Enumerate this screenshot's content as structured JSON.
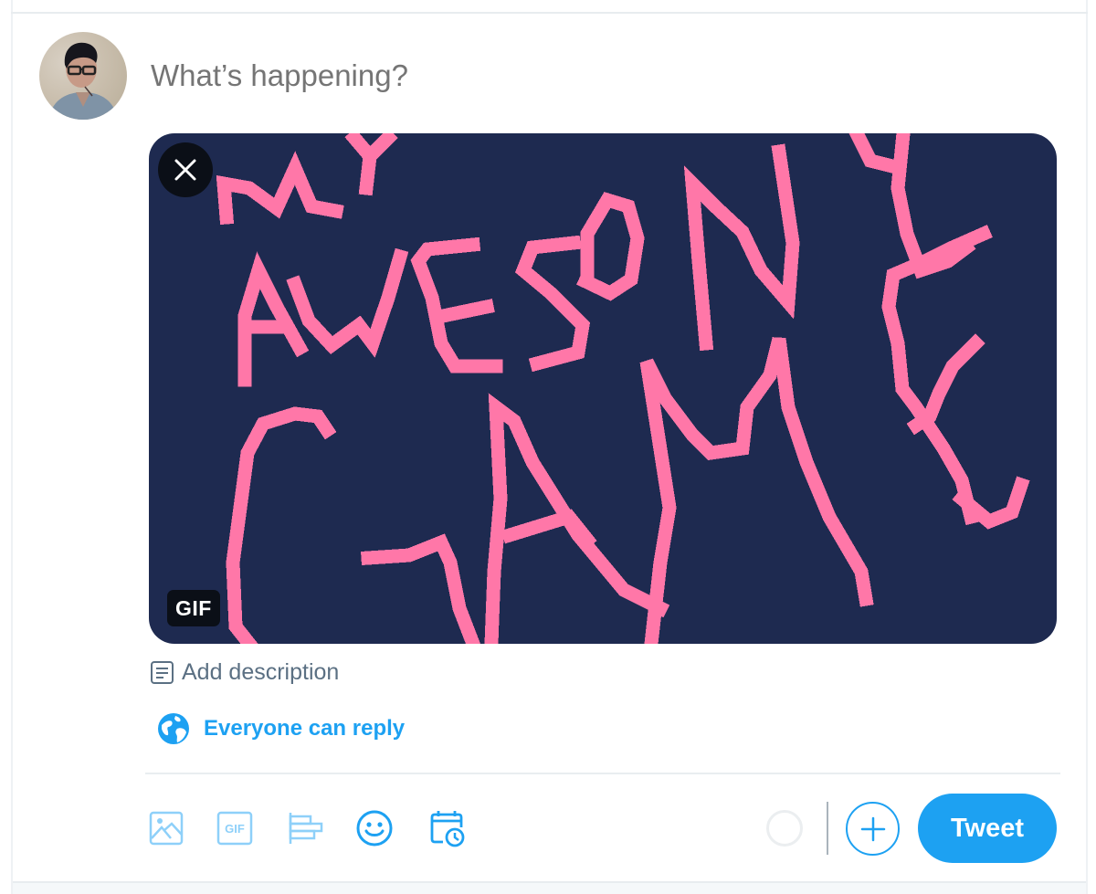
{
  "composer": {
    "placeholder": "What’s happening?",
    "value": ""
  },
  "user": {
    "avatar_icon": "user-avatar-photo"
  },
  "media": {
    "type": "GIF",
    "badge_label": "GIF",
    "artwork_text": "MY AWESOME GAME",
    "background_color": "#1e2a50",
    "stroke_color": "#ff77a8",
    "remove_icon": "close-icon"
  },
  "add_description": {
    "label": "Add description",
    "icon": "document-icon"
  },
  "reply_setting": {
    "label": "Everyone can reply",
    "icon": "globe-icon"
  },
  "toolbar": {
    "items": [
      {
        "name": "media",
        "icon": "image-icon",
        "enabled": false
      },
      {
        "name": "gif",
        "icon": "gif-icon",
        "label": "GIF",
        "enabled": false
      },
      {
        "name": "poll",
        "icon": "poll-icon",
        "enabled": false
      },
      {
        "name": "emoji",
        "icon": "emoji-icon",
        "enabled": true
      },
      {
        "name": "schedule",
        "icon": "schedule-icon",
        "enabled": true
      }
    ]
  },
  "actions": {
    "add_thread_icon": "plus-icon",
    "tweet_label": "Tweet"
  },
  "colors": {
    "accent": "#1da1f2",
    "accent_disabled": "#8ed0f9",
    "placeholder_text": "#5b7083",
    "divider": "#e9edf0"
  }
}
